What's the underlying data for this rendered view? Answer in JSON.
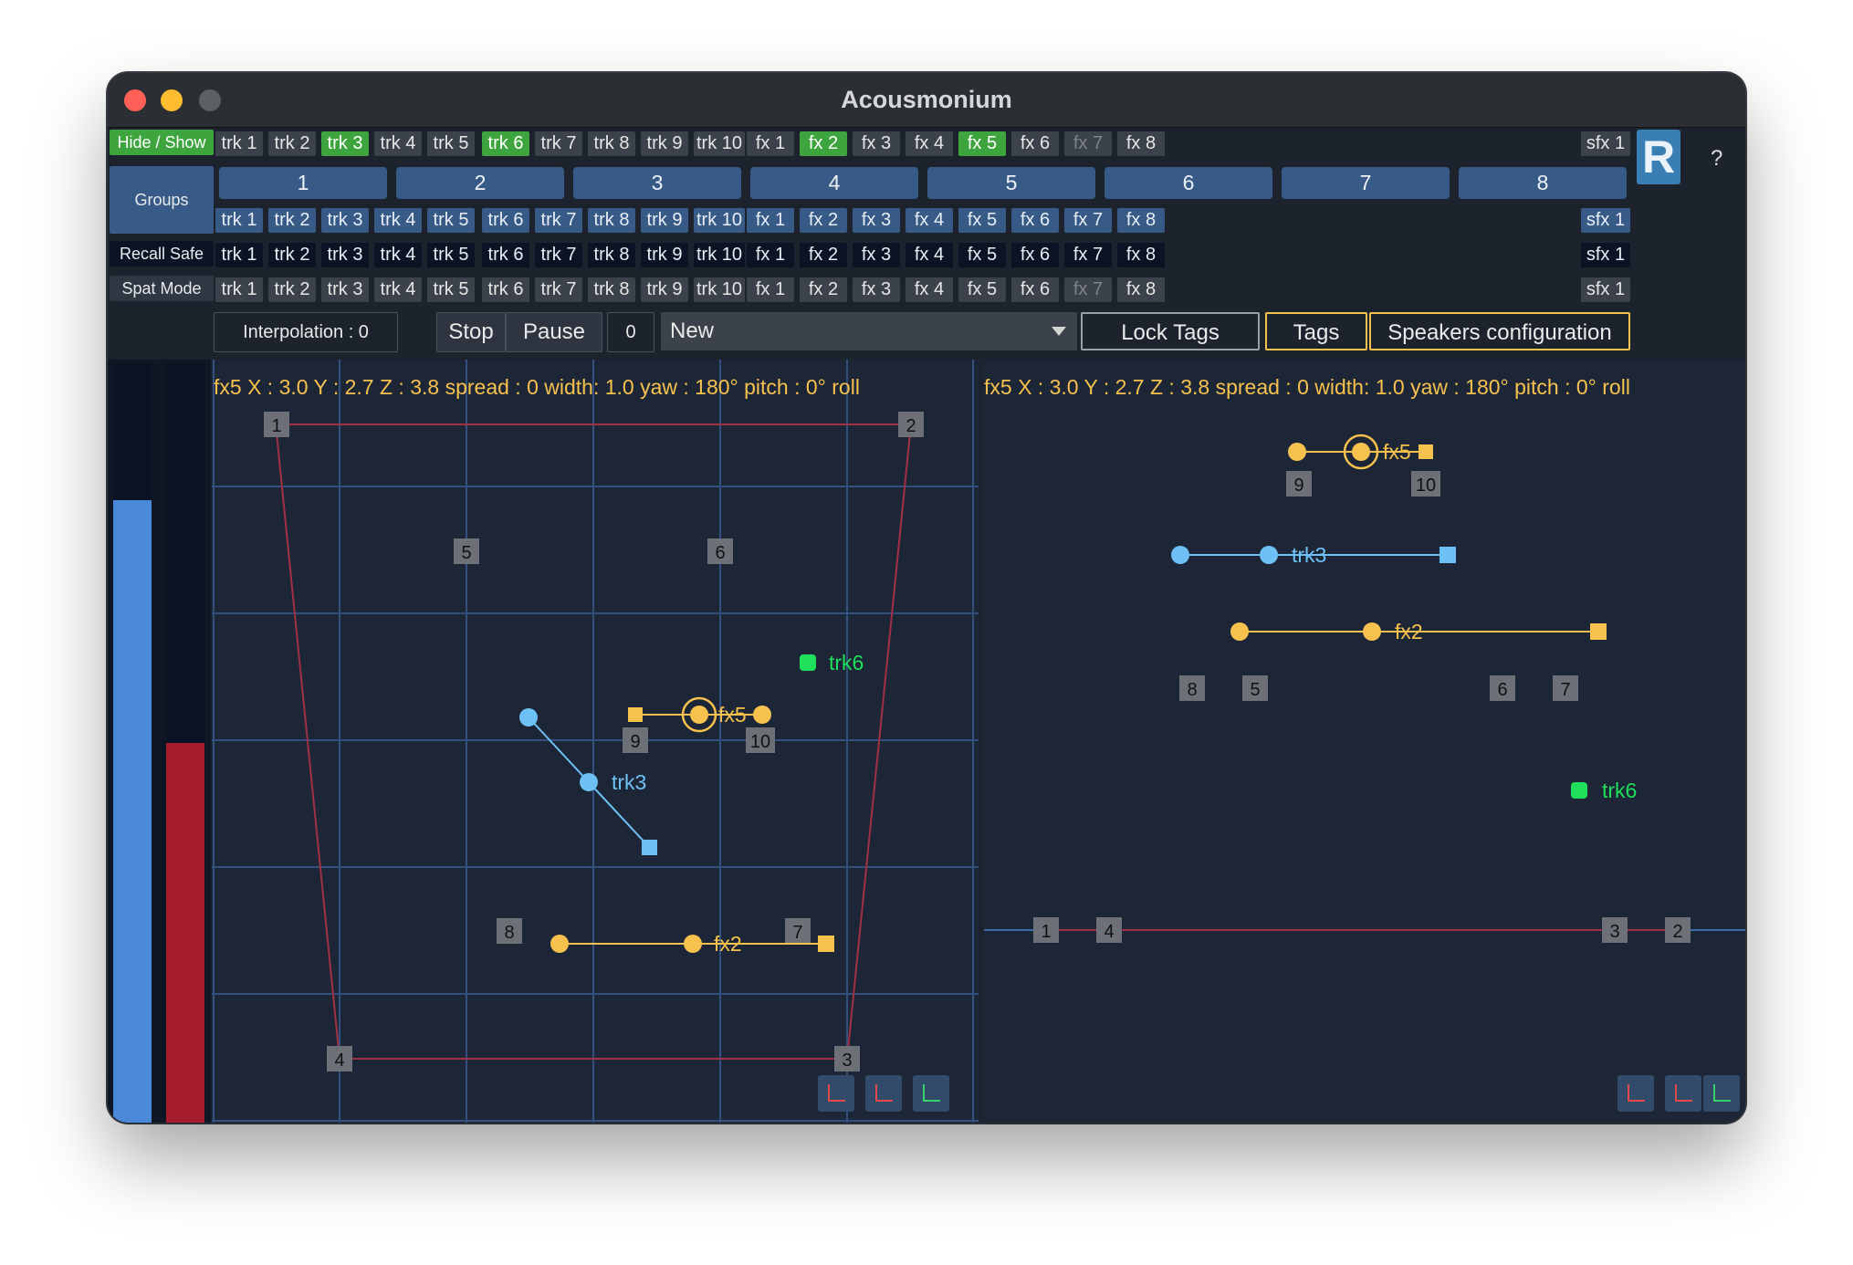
{
  "window": {
    "title": "Acousmonium"
  },
  "rows": {
    "hide_show": {
      "label": "Hide / Show",
      "items": [
        {
          "label": "trk 1",
          "state": "normal"
        },
        {
          "label": "trk 2",
          "state": "normal"
        },
        {
          "label": "trk 3",
          "state": "on"
        },
        {
          "label": "trk 4",
          "state": "normal"
        },
        {
          "label": "trk 5",
          "state": "normal"
        },
        {
          "label": "trk 6",
          "state": "on"
        },
        {
          "label": "trk 7",
          "state": "normal"
        },
        {
          "label": "trk 8",
          "state": "normal"
        },
        {
          "label": "trk 9",
          "state": "normal"
        },
        {
          "label": "trk 10",
          "state": "normal"
        },
        {
          "label": "fx 1",
          "state": "normal"
        },
        {
          "label": "fx 2",
          "state": "on"
        },
        {
          "label": "fx 3",
          "state": "normal"
        },
        {
          "label": "fx 4",
          "state": "normal"
        },
        {
          "label": "fx 5",
          "state": "on"
        },
        {
          "label": "fx 6",
          "state": "normal"
        },
        {
          "label": "fx 7",
          "state": "dim"
        },
        {
          "label": "fx 8",
          "state": "normal"
        }
      ],
      "sfx": "sfx 1"
    },
    "groups": {
      "label": "Groups",
      "numbers": [
        "1",
        "2",
        "3",
        "4",
        "5",
        "6",
        "7",
        "8"
      ],
      "items": [
        "trk 1",
        "trk 2",
        "trk 3",
        "trk 4",
        "trk 5",
        "trk 6",
        "trk 7",
        "trk 8",
        "trk 9",
        "trk 10",
        "fx 1",
        "fx 2",
        "fx 3",
        "fx 4",
        "fx 5",
        "fx 6",
        "fx 7",
        "fx 8"
      ],
      "sfx": "sfx 1"
    },
    "recall_safe": {
      "label": "Recall Safe",
      "items": [
        "trk 1",
        "trk 2",
        "trk 3",
        "trk 4",
        "trk 5",
        "trk 6",
        "trk 7",
        "trk 8",
        "trk 9",
        "trk 10",
        "fx 1",
        "fx 2",
        "fx 3",
        "fx 4",
        "fx 5",
        "fx 6",
        "fx 7",
        "fx 8"
      ],
      "sfx": "sfx 1"
    },
    "spat_mode": {
      "label": "Spat Mode",
      "items": [
        {
          "label": "trk 1",
          "state": "normal"
        },
        {
          "label": "trk 2",
          "state": "normal"
        },
        {
          "label": "trk 3",
          "state": "normal"
        },
        {
          "label": "trk 4",
          "state": "normal"
        },
        {
          "label": "trk 5",
          "state": "normal"
        },
        {
          "label": "trk 6",
          "state": "normal"
        },
        {
          "label": "trk 7",
          "state": "normal"
        },
        {
          "label": "trk 8",
          "state": "normal"
        },
        {
          "label": "trk 9",
          "state": "normal"
        },
        {
          "label": "trk 10",
          "state": "normal"
        },
        {
          "label": "fx 1",
          "state": "normal"
        },
        {
          "label": "fx 2",
          "state": "normal"
        },
        {
          "label": "fx 3",
          "state": "normal"
        },
        {
          "label": "fx 4",
          "state": "normal"
        },
        {
          "label": "fx 5",
          "state": "normal"
        },
        {
          "label": "fx 6",
          "state": "normal"
        },
        {
          "label": "fx 7",
          "state": "dim"
        },
        {
          "label": "fx 8",
          "state": "normal"
        }
      ],
      "sfx": "sfx 1"
    }
  },
  "side_buttons": {
    "r_label": "R",
    "help_label": "?"
  },
  "controls": {
    "interpolation": "Interpolation : 0",
    "stop": "Stop",
    "pause": "Pause",
    "counter": "0",
    "preset": "New",
    "lock_tags": "Lock Tags",
    "tags": "Tags",
    "speakers": "Speakers configuration"
  },
  "info_text": "fx5   X : 3.0   Y : 2.7  Z : 3.8  spread : 0 width:  1.0  yaw : 180° pitch : 0° roll",
  "meters": {
    "left_level": 0.82,
    "right_level": 0.5,
    "left_color": "#4a88da",
    "right_color": "#a51d2d"
  },
  "colors": {
    "fx": "#f7c14e",
    "trk_blue": "#6ec1f5",
    "trk_green": "#1fe05a",
    "speaker_line": "#a03044",
    "grid": "#33517c"
  },
  "top_view": {
    "speakers": [
      "1",
      "2",
      "3",
      "4",
      "5",
      "6",
      "7",
      "8",
      "9",
      "10"
    ],
    "sources": {
      "trk6": "trk6",
      "trk3": "trk3",
      "fx5": "fx5",
      "fx2": "fx2"
    }
  },
  "side_view": {
    "speakers": [
      "1",
      "2",
      "3",
      "4",
      "5",
      "6",
      "7",
      "8",
      "9",
      "10"
    ],
    "sources": {
      "trk6": "trk6",
      "trk3": "trk3",
      "fx5": "fx5",
      "fx2": "fx2"
    }
  },
  "view_icons": [
    "axis-icon",
    "axis-icon",
    "axis-icon"
  ]
}
